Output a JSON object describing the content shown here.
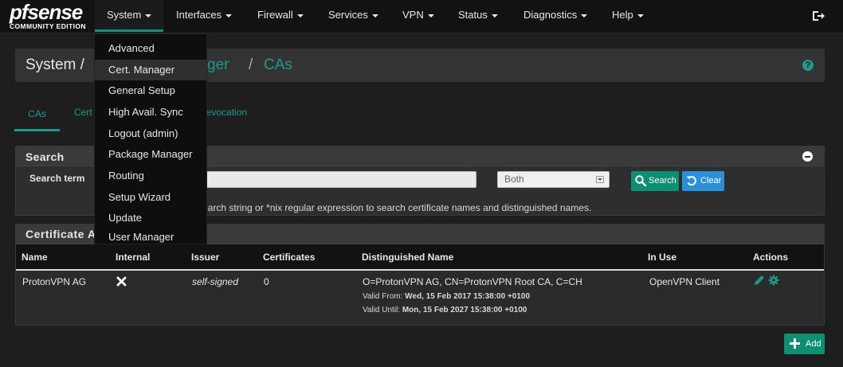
{
  "brand": {
    "name": "pfsense",
    "edition": "COMMUNITY EDITION"
  },
  "nav": {
    "items": [
      {
        "label": "System"
      },
      {
        "label": "Interfaces"
      },
      {
        "label": "Firewall"
      },
      {
        "label": "Services"
      },
      {
        "label": "VPN"
      },
      {
        "label": "Status"
      },
      {
        "label": "Diagnostics"
      },
      {
        "label": "Help"
      }
    ],
    "logout_icon": "logout-icon"
  },
  "system_menu": {
    "items": [
      {
        "label": "Advanced"
      },
      {
        "label": "Cert. Manager"
      },
      {
        "label": "General Setup"
      },
      {
        "label": "High Avail. Sync"
      },
      {
        "label": "Logout (admin)"
      },
      {
        "label": "Package Manager"
      },
      {
        "label": "Routing"
      },
      {
        "label": "Setup Wizard"
      },
      {
        "label": "Update"
      },
      {
        "label": "User Manager"
      }
    ]
  },
  "breadcrumb": {
    "system": "System /",
    "manager_partial": "ger",
    "sep": "/",
    "current": "CAs"
  },
  "tabs": {
    "cas": "CAs",
    "certs_partial": "Cert",
    "rev_partial": "Revocation"
  },
  "search": {
    "title": "Search",
    "label": "Search term",
    "input_value": "",
    "select_value": "Both",
    "search_button": "Search",
    "clear_button": "Clear",
    "help_text_partial": "Enter a search string or *nix regular expression to search certificate names and distinguished names."
  },
  "ca_panel": {
    "title_partial": "Certificate Au",
    "columns": [
      "Name",
      "Internal",
      "Issuer",
      "Certificates",
      "Distinguished Name",
      "In Use",
      "Actions"
    ],
    "rows": [
      {
        "name": "ProtonVPN AG",
        "issuer": "self-signed",
        "certificates": "0",
        "dn": "O=ProtonVPN AG, CN=ProtonVPN Root CA, C=CH",
        "valid_from_label": "Valid From:",
        "valid_from": "Wed, 15 Feb 2017 15:38:00 +0100",
        "valid_until_label": "Valid Until:",
        "valid_until": "Mon, 15 Feb 2027 15:38:00 +0100",
        "in_use": "OpenVPN Client"
      }
    ]
  },
  "add_button": "Add",
  "colors": {
    "accent": "#1d9a8a",
    "search_btn": "#0d8f74",
    "clear_btn": "#2b8fd9"
  }
}
